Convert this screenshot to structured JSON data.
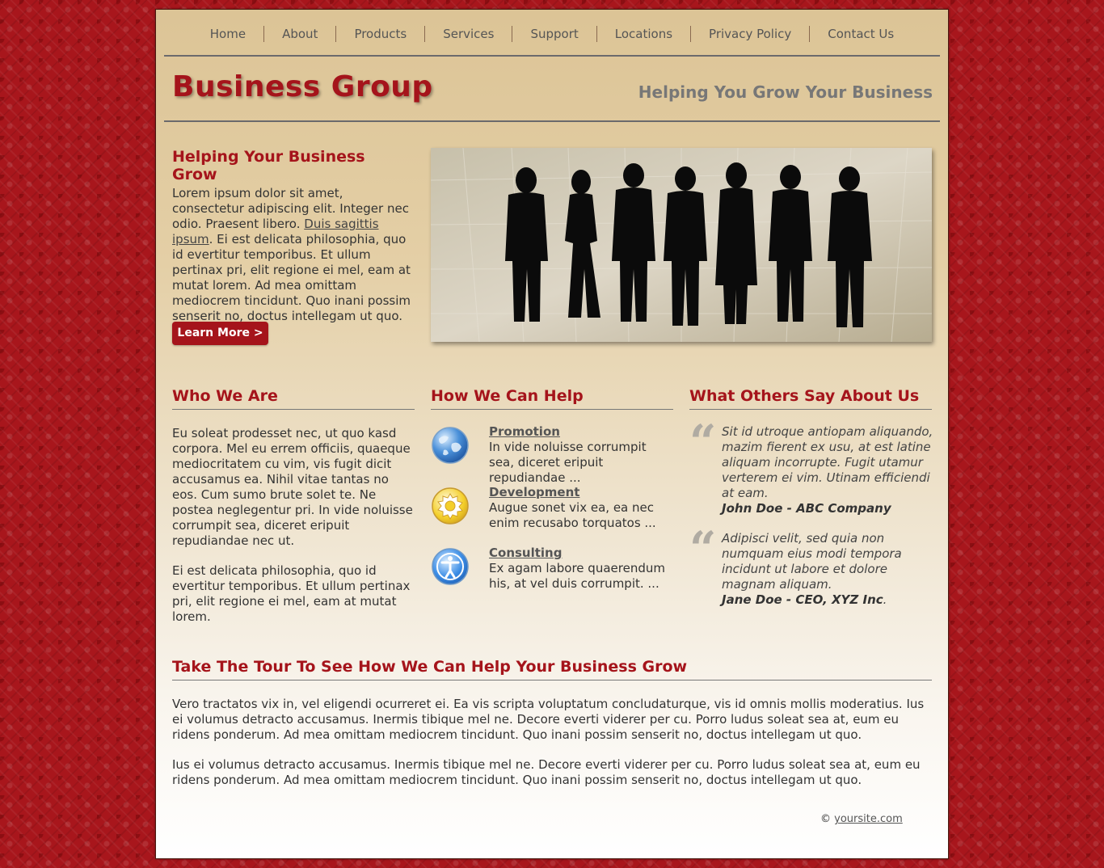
{
  "nav": {
    "items": [
      "Home",
      "About",
      "Products",
      "Services",
      "Support",
      "Locations",
      "Privacy Policy",
      "Contact Us"
    ]
  },
  "header": {
    "logo": "Business Group",
    "tagline": "Helping You Grow Your Business"
  },
  "intro": {
    "title": "Helping Your Business Grow",
    "text_before_link": "Lorem ipsum dolor sit amet, consectetur adipiscing elit. Integer nec odio. Praesent libero. ",
    "link": "Duis sagittis ipsum",
    "text_after_link": ". Ei est delicata philosophia, quo id evertitur temporibus. Et ullum pertinax pri, elit regione ei mel, eam at mutat lorem. Ad mea omittam mediocrem tincidunt. Quo inani possim senserit no, doctus intellegam ut quo.",
    "button": "Learn More >"
  },
  "who": {
    "title": "Who We Are",
    "p1": "Eu soleat prodesset nec, ut quo kasd corpora. Mel eu errem officiis, quaeque mediocritatem cu vim, vis fugit dicit accusamus ea. Nihil vitae tantas no eos. Cum sumo brute solet te. Ne postea neglegentur pri. In vide noluisse corrumpit sea, diceret eripuit repudiandae nec ut.",
    "p2": "Ei est delicata philosophia, quo id evertitur temporibus. Et ullum pertinax pri, elit regione ei mel, eam at mutat lorem."
  },
  "help": {
    "title": "How We Can Help",
    "items": [
      {
        "icon": "globe-icon",
        "title": "Promotion",
        "text": "In vide noluisse corrumpit sea, diceret eripuit repudiandae ..."
      },
      {
        "icon": "gear-icon",
        "title": "Development",
        "text": "Augue sonet vix ea, ea nec enim recusabo torquatos ..."
      },
      {
        "icon": "accessibility-icon",
        "title": "Consulting",
        "text": "Ex agam labore quaerendum his, at vel duis corrumpit. ..."
      }
    ]
  },
  "testimonials": {
    "title": "What Others Say About Us",
    "quotes": [
      {
        "text": "Sit id utroque antiopam aliquando, mazim fierent ex usu, at est latine aliquam incorrupte. Fugit utamur verterem ei vim. Utinam efficiendi at eam.",
        "author": "John Doe - ABC Company",
        "author_suffix": ""
      },
      {
        "text": "Adipisci velit, sed quia non numquam eius modi tempora incidunt ut labore et dolore magnam aliquam.",
        "author": "Jane Doe - CEO, XYZ Inc",
        "author_suffix": "."
      }
    ]
  },
  "tour": {
    "title": "Take The Tour To See How We Can Help Your Business Grow",
    "p1": "Vero tractatos vix in, vel eligendi ocurreret ei. Ea vis scripta voluptatum concludaturque, vis id omnis mollis moderatius. Ius ei volumus detracto accusamus. Inermis tibique mel ne. Decore everti viderer per cu. Porro ludus soleat sea at, eum eu ridens ponderum. Ad mea omittam mediocrem tincidunt. Quo inani possim senserit no, doctus intellegam ut quo.",
    "p2": "Ius ei volumus detracto accusamus. Inermis tibique mel ne. Decore everti viderer per cu. Porro ludus soleat sea at, eum eu ridens ponderum. Ad mea omittam mediocrem tincidunt. Quo inani possim senserit no, doctus intellegam ut quo."
  },
  "footer": {
    "copyright_symbol": "©",
    "link": "yoursite.com"
  },
  "colors": {
    "accent": "#a5141b",
    "page_background": "#a8161c"
  }
}
